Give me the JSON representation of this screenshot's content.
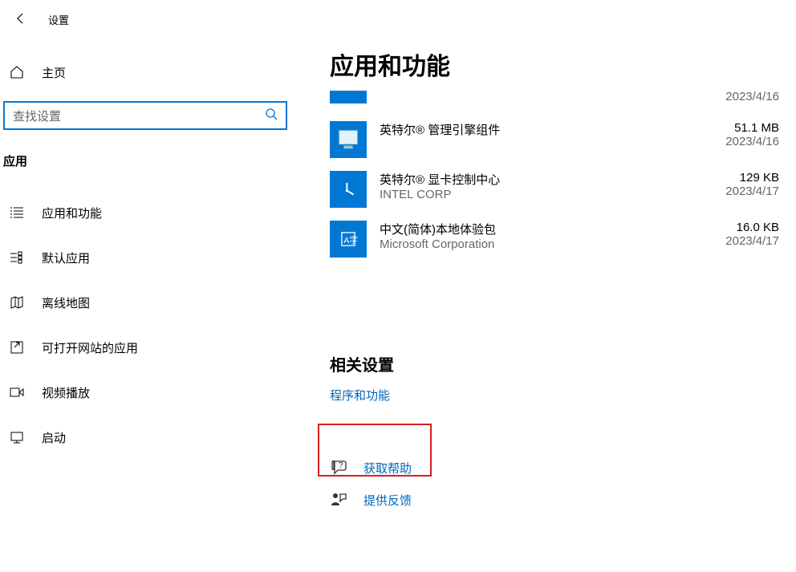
{
  "window": {
    "title": "设置"
  },
  "sidebar": {
    "home": "主页",
    "search_placeholder": "查找设置",
    "section": "应用",
    "items": [
      {
        "label": "应用和功能"
      },
      {
        "label": "默认应用"
      },
      {
        "label": "离线地图"
      },
      {
        "label": "可打开网站的应用"
      },
      {
        "label": "视频播放"
      },
      {
        "label": "启动"
      }
    ]
  },
  "main": {
    "heading": "应用和功能",
    "partial_date": "2023/4/16",
    "apps": [
      {
        "name": "英特尔® 管理引擎组件",
        "publisher": "",
        "size": "51.1 MB",
        "date": "2023/4/16"
      },
      {
        "name": "英特尔® 显卡控制中心",
        "publisher": "INTEL CORP",
        "size": "129 KB",
        "date": "2023/4/17"
      },
      {
        "name": "中文(简体)本地体验包",
        "publisher": "Microsoft Corporation",
        "size": "16.0 KB",
        "date": "2023/4/17"
      }
    ],
    "related_heading": "相关设置",
    "related_link": "程序和功能",
    "help": "获取帮助",
    "feedback": "提供反馈"
  }
}
